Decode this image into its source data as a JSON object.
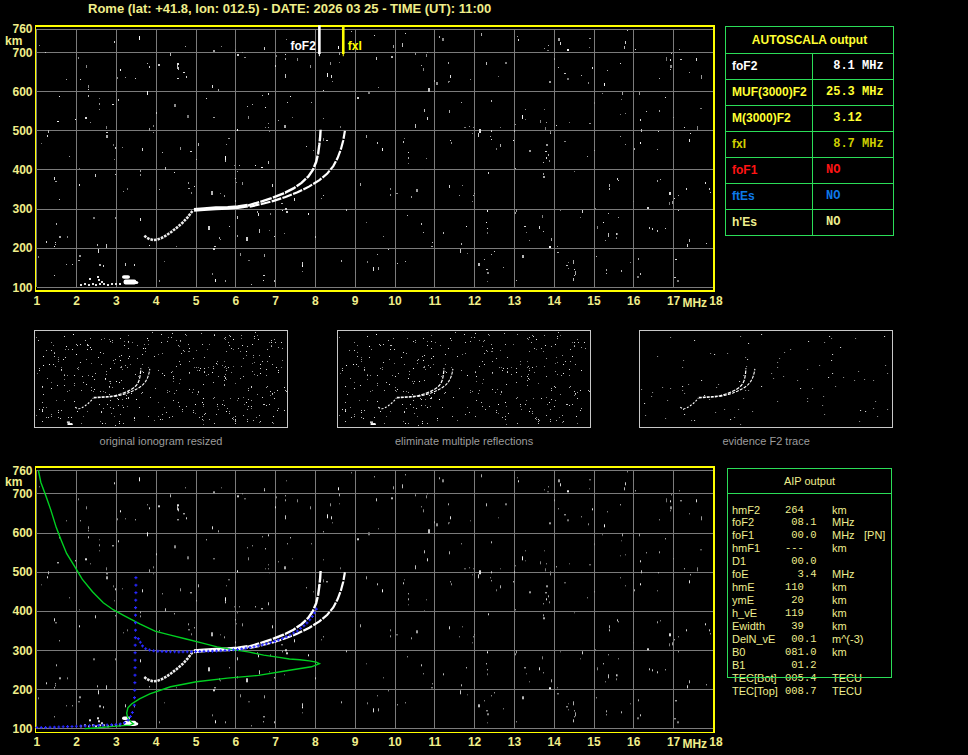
{
  "title": {
    "text": "Rome (lat: +41.8, lon: 012.5) - DATE: 2026 03 25 - TIME (UT): 11:00"
  },
  "colors": {
    "background": "#000000",
    "pale_yellow": "#f0ee8a",
    "bright_yellow": "#ffff00",
    "frame_yellow": "#ffff00",
    "grid_gray": "#7b7b7b",
    "table_green": "#2bdd58",
    "trace_white": "#ffffff",
    "hook_white": "#ececec",
    "profile_green": "#00d022",
    "model_blue": "#2828ff",
    "marker_fof2_white": "#ffffff",
    "marker_fxi_yellow": "#ffff00",
    "caption_gray": "#9c9c9c",
    "red": "#ff1414",
    "blue": "#0d78e8",
    "olive_yellow": "#cfd000",
    "table_yellow": "#ffff33",
    "aip_text": "#eeee8e",
    "panel_border": "#c8c8c8"
  },
  "autoscala_table": {
    "header": "AUTOSCALA output",
    "rows": [
      {
        "label": "foF2",
        "value": " 8.1 MHz",
        "color": "#ffffff"
      },
      {
        "label": "MUF(3000)F2",
        "value": "25.3 MHz",
        "color": "#ffff33"
      },
      {
        "label": "M(3000)F2",
        "value": " 3.12",
        "color": "#ffff33"
      },
      {
        "label": "fxI",
        "value": " 8.7 MHz",
        "color": "#cfd000"
      },
      {
        "label": "foF1",
        "value": "NO",
        "color": "#ff1414"
      },
      {
        "label": "ftEs",
        "value": "NO",
        "color": "#0d78e8"
      },
      {
        "label": "h'Es",
        "value": "NO",
        "color": "#eeee8e"
      }
    ]
  },
  "aip_table": {
    "header": "AIP output",
    "rows": [
      {
        "label": "hmF2",
        "value": "264",
        "unit": "km",
        "extra": ""
      },
      {
        "label": "foF2",
        "value": " 08.1",
        "unit": "MHz",
        "extra": ""
      },
      {
        "label": "foF1",
        "value": " 00.0",
        "unit": "MHz",
        "extra": "[PN]"
      },
      {
        "label": "hmF1",
        "value": "---",
        "unit": "km",
        "extra": ""
      },
      {
        "label": "D1",
        "value": " 00.0",
        "unit": "",
        "extra": ""
      },
      {
        "label": "foE",
        "value": "  3.4",
        "unit": "MHz",
        "extra": ""
      },
      {
        "label": "hmE",
        "value": "110",
        "unit": "km",
        "extra": ""
      },
      {
        "label": "ymE",
        "value": " 20",
        "unit": "km",
        "extra": ""
      },
      {
        "label": "h_vE",
        "value": "119",
        "unit": "km",
        "extra": ""
      },
      {
        "label": "Ewidth",
        "value": " 39",
        "unit": "km",
        "extra": ""
      },
      {
        "label": "DelN_vE",
        "value": " 00.1",
        "unit": "m^(-3)",
        "extra": ""
      },
      {
        "label": "B0",
        "value": "081.0",
        "unit": "km",
        "extra": ""
      },
      {
        "label": "B1",
        "value": " 01.2",
        "unit": "",
        "extra": ""
      },
      {
        "label": "TEC[Bot]",
        "value": "005.4",
        "unit": "TECU",
        "extra": ""
      },
      {
        "label": "TEC[Top]",
        "value": "008.7",
        "unit": "TECU",
        "extra": ""
      }
    ]
  },
  "panels": [
    {
      "caption": "original ionogram resized"
    },
    {
      "caption": "eliminate multiple reflections"
    },
    {
      "caption": "evidence F2 trace"
    }
  ],
  "chart_data": {
    "type": "ionogram",
    "x_axis": {
      "label": "MHz",
      "min": 1,
      "max": 18,
      "ticks": [
        1,
        2,
        3,
        4,
        5,
        6,
        7,
        8,
        9,
        10,
        11,
        12,
        13,
        14,
        15,
        16,
        17,
        18
      ]
    },
    "y_axis": {
      "label": "km",
      "min": 100,
      "max": 760,
      "ticks": [
        760,
        700,
        600,
        500,
        400,
        300,
        200,
        100
      ]
    },
    "markers": [
      {
        "label": "foF2",
        "freq": 8.1,
        "color": "#ffffff"
      },
      {
        "label": "fxI",
        "freq": 8.7,
        "color": "#ffff00"
      }
    ],
    "trace": {
      "hook": [
        [
          3.7,
          232
        ],
        [
          3.76,
          227
        ],
        [
          3.84,
          223
        ],
        [
          3.93,
          221
        ],
        [
          4.03,
          222
        ],
        [
          4.13,
          226
        ],
        [
          4.24,
          232
        ],
        [
          4.37,
          241
        ],
        [
          4.51,
          252
        ],
        [
          4.66,
          265
        ],
        [
          4.79,
          279
        ],
        [
          4.91,
          295
        ]
      ],
      "band": [
        [
          4.95,
          298
        ],
        [
          5.2,
          300
        ],
        [
          5.5,
          302
        ],
        [
          5.8,
          303
        ],
        [
          6.05,
          305
        ],
        [
          6.3,
          309
        ]
      ],
      "o_branch": [
        [
          6.3,
          309
        ],
        [
          6.6,
          318
        ],
        [
          6.9,
          328
        ],
        [
          7.2,
          340
        ],
        [
          7.45,
          353
        ],
        [
          7.65,
          367
        ],
        [
          7.82,
          383
        ],
        [
          7.94,
          401
        ],
        [
          8.02,
          421
        ],
        [
          8.07,
          443
        ],
        [
          8.1,
          466
        ],
        [
          8.12,
          486
        ],
        [
          8.13,
          503
        ]
      ],
      "x_branch": [
        [
          6.35,
          306
        ],
        [
          6.65,
          313
        ],
        [
          6.95,
          321
        ],
        [
          7.25,
          331
        ],
        [
          7.55,
          343
        ],
        [
          7.85,
          358
        ],
        [
          8.1,
          374
        ],
        [
          8.3,
          391
        ],
        [
          8.45,
          410
        ],
        [
          8.56,
          431
        ],
        [
          8.64,
          453
        ],
        [
          8.7,
          476
        ],
        [
          8.74,
          500
        ]
      ],
      "e_dots": [
        [
          2.08,
          108
        ],
        [
          2.18,
          110
        ],
        [
          2.28,
          108
        ],
        [
          2.38,
          111
        ],
        [
          2.47,
          109
        ],
        [
          2.56,
          112
        ],
        [
          2.55,
          120
        ],
        [
          2.62,
          117
        ],
        [
          2.66,
          110
        ],
        [
          2.76,
          109
        ],
        [
          2.86,
          111
        ],
        [
          2.96,
          110
        ],
        [
          3.06,
          112
        ],
        [
          2.3,
          125
        ],
        [
          2.52,
          128
        ]
      ],
      "e_blobs": [
        [
          3.14,
          3.34,
          122,
          131
        ],
        [
          3.18,
          3.5,
          107,
          120
        ],
        [
          3.42,
          3.55,
          108,
          116
        ]
      ]
    },
    "profile_green": [
      [
        1.04,
        760
      ],
      [
        1.1,
        730
      ],
      [
        1.23,
        694
      ],
      [
        1.35,
        660
      ],
      [
        1.49,
        614
      ],
      [
        1.62,
        580
      ],
      [
        1.75,
        548
      ],
      [
        1.95,
        515
      ],
      [
        2.14,
        482
      ],
      [
        2.4,
        450
      ],
      [
        2.67,
        422
      ],
      [
        2.92,
        404
      ],
      [
        3.19,
        389
      ],
      [
        3.6,
        367
      ],
      [
        3.97,
        349
      ],
      [
        4.36,
        339
      ],
      [
        4.75,
        329
      ],
      [
        5.14,
        319
      ],
      [
        5.53,
        309
      ],
      [
        5.92,
        302
      ],
      [
        6.31,
        296
      ],
      [
        6.7,
        288
      ],
      [
        7.09,
        282
      ],
      [
        7.35,
        278
      ],
      [
        7.61,
        276
      ],
      [
        7.85,
        273
      ],
      [
        8.02,
        270
      ],
      [
        8.1,
        266
      ],
      [
        7.9,
        258
      ],
      [
        7.35,
        249
      ],
      [
        6.57,
        236
      ],
      [
        5.79,
        229
      ],
      [
        5.01,
        220
      ],
      [
        4.36,
        207
      ],
      [
        3.84,
        189
      ],
      [
        3.58,
        176
      ],
      [
        3.38,
        163
      ],
      [
        3.29,
        153
      ],
      [
        3.26,
        140
      ],
      [
        3.28,
        130
      ],
      [
        3.31,
        124
      ],
      [
        3.37,
        117
      ],
      [
        3.43,
        112
      ],
      [
        3.35,
        109
      ],
      [
        3.08,
        107
      ],
      [
        2.85,
        105
      ],
      [
        2.54,
        102
      ],
      [
        2.38,
        101
      ],
      [
        2.2,
        100
      ]
    ],
    "model_blue": {
      "e_branch": [
        [
          1.0,
          103
        ],
        [
          1.25,
          103
        ],
        [
          1.5,
          104
        ],
        [
          1.75,
          105
        ],
        [
          2.0,
          106
        ],
        [
          2.25,
          107
        ],
        [
          2.5,
          108
        ],
        [
          2.75,
          109
        ],
        [
          2.95,
          110
        ],
        [
          3.1,
          112
        ],
        [
          3.2,
          115
        ],
        [
          3.3,
          122
        ],
        [
          3.35,
          130
        ],
        [
          3.4,
          140
        ],
        [
          3.42,
          151
        ]
      ],
      "cusp": [
        [
          3.45,
          160
        ],
        [
          3.46,
          200
        ],
        [
          3.47,
          250
        ],
        [
          3.47,
          300
        ],
        [
          3.48,
          350
        ],
        [
          3.48,
          400
        ],
        [
          3.49,
          450
        ],
        [
          3.49,
          490
        ]
      ],
      "f_branch": [
        [
          3.55,
          330
        ],
        [
          3.65,
          312
        ],
        [
          3.75,
          303
        ],
        [
          3.9,
          299
        ],
        [
          4.2,
          297
        ],
        [
          4.6,
          296
        ],
        [
          5.0,
          297
        ],
        [
          5.4,
          298
        ],
        [
          5.8,
          300
        ],
        [
          6.1,
          303
        ],
        [
          6.4,
          308
        ],
        [
          6.7,
          315
        ],
        [
          7.0,
          324
        ],
        [
          7.3,
          336
        ],
        [
          7.55,
          350
        ],
        [
          7.75,
          366
        ],
        [
          7.9,
          383
        ],
        [
          8.0,
          400
        ],
        [
          8.05,
          412
        ]
      ]
    },
    "noise": {
      "seed": 20260325,
      "count": 480,
      "panel3_count": 95
    }
  }
}
